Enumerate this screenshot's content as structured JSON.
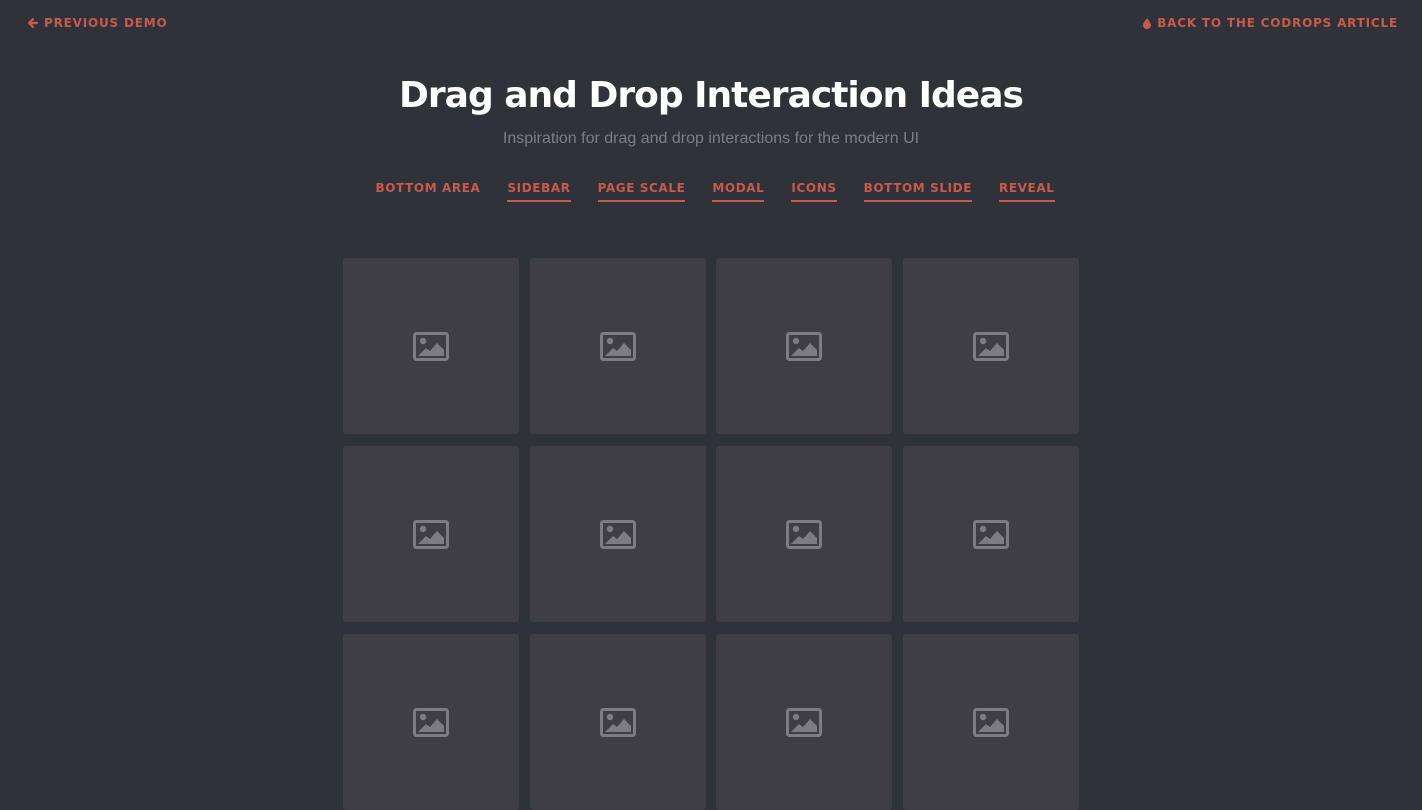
{
  "topbar": {
    "previous_demo": "PREVIOUS DEMO",
    "previous_icon": "arrow-left-icon",
    "back_article": "BACK TO THE CODROPS ARTICLE",
    "back_icon": "drop-icon"
  },
  "header": {
    "title": "Drag and Drop Interaction Ideas",
    "subtitle": "Inspiration for drag and drop interactions for the modern UI"
  },
  "nav": {
    "items": [
      {
        "label": "BOTTOM AREA",
        "current": true
      },
      {
        "label": "SIDEBAR",
        "current": false
      },
      {
        "label": "PAGE SCALE",
        "current": false
      },
      {
        "label": "MODAL",
        "current": false
      },
      {
        "label": "ICONS",
        "current": false
      },
      {
        "label": "BOTTOM SLIDE",
        "current": false
      },
      {
        "label": "REVEAL",
        "current": false
      }
    ]
  },
  "grid": {
    "tile_icon": "image-icon",
    "tile_count": 12
  },
  "colors": {
    "background": "#30323a",
    "accent": "#c75b4b",
    "tile": "#3e3e44",
    "tile_icon": "#7d7c82",
    "subtitle": "#7c7e86",
    "title": "#ffffff"
  }
}
